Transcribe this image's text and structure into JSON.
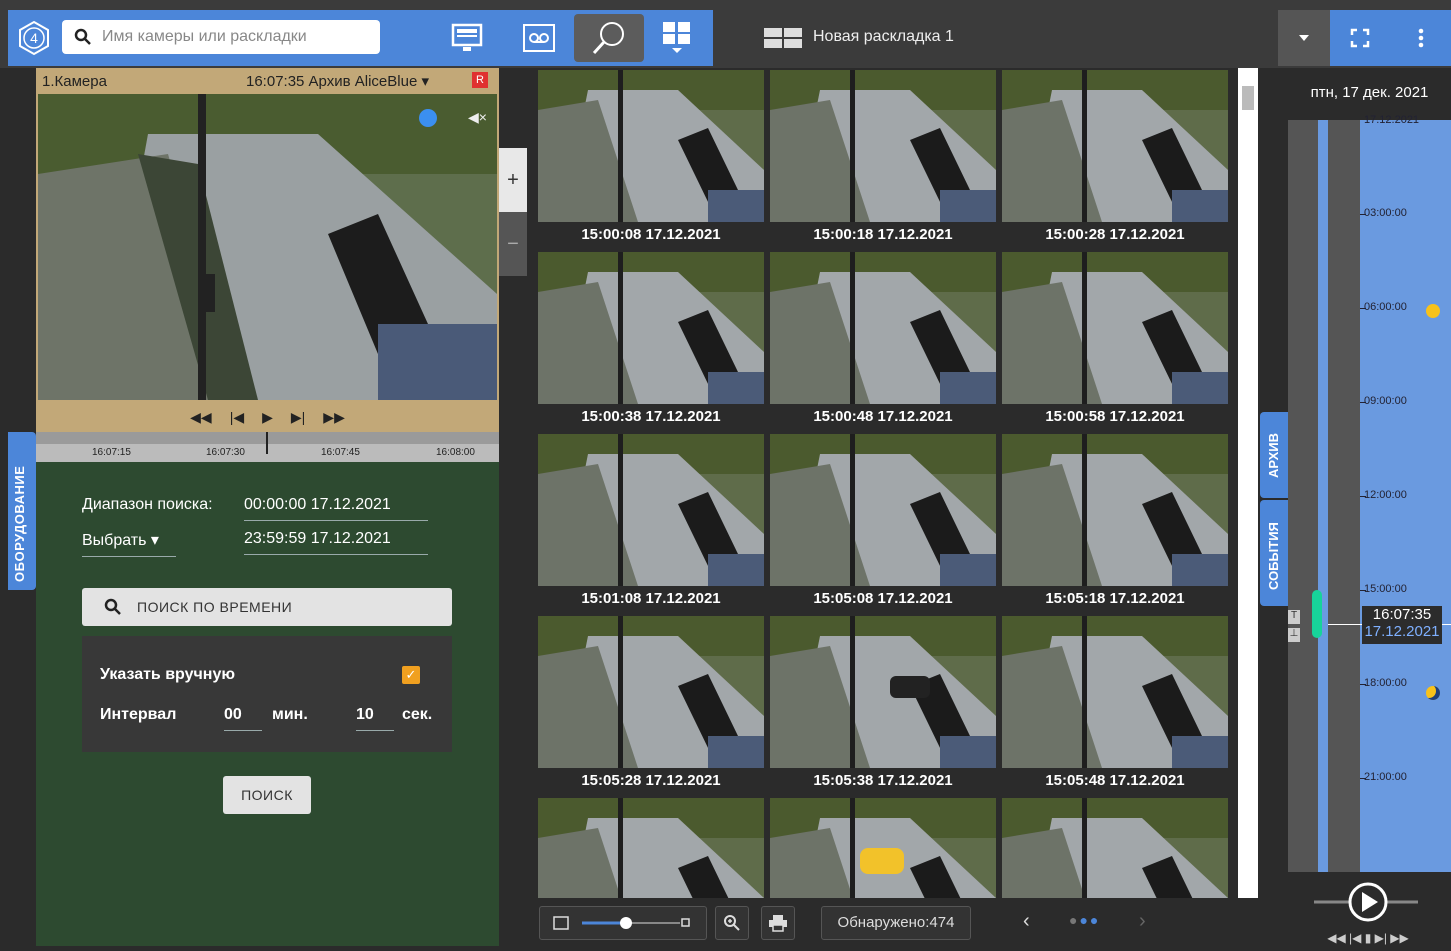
{
  "topbar": {
    "logo_label": "4",
    "search_placeholder": "Имя камеры или раскладки",
    "layout_name": "Новая раскладка 1",
    "buttons": [
      "monitor-icon",
      "archive-icon",
      "search-icon",
      "layouts-icon",
      "fullscreen-icon",
      "more-icon"
    ]
  },
  "equipment_tab": "ОБОРУДОВАНИЕ",
  "camera": {
    "name": "1.Камера",
    "status": "16:07:35 Архив AliceBlue",
    "record_badge": "R",
    "timeline_ticks": [
      "16:07:15",
      "16:07:30",
      "16:07:45",
      "16:08:00"
    ]
  },
  "search_panel": {
    "range_label": "Диапазон поиска:",
    "range_start": "00:00:00 17.12.2021",
    "select_label": "Выбрать",
    "range_end": "23:59:59 17.12.2021",
    "time_search_button": "ПОИСК ПО ВРЕМЕНИ",
    "manual_label": "Указать вручную",
    "manual_checked": true,
    "interval_label": "Интервал",
    "minutes_value": "00",
    "minutes_unit": "мин.",
    "seconds_value": "10",
    "seconds_unit": "сек.",
    "search_button": "ПОИСК"
  },
  "zoom": {
    "plus": "+",
    "minus": "−"
  },
  "thumbnails": [
    {
      "label": "15:00:08 17.12.2021"
    },
    {
      "label": "15:00:18 17.12.2021"
    },
    {
      "label": "15:00:28 17.12.2021"
    },
    {
      "label": "15:00:38 17.12.2021"
    },
    {
      "label": "15:00:48 17.12.2021"
    },
    {
      "label": "15:00:58 17.12.2021"
    },
    {
      "label": "15:01:08 17.12.2021"
    },
    {
      "label": "15:05:08 17.12.2021"
    },
    {
      "label": "15:05:18 17.12.2021"
    },
    {
      "label": "15:05:28 17.12.2021"
    },
    {
      "label": "15:05:38 17.12.2021"
    },
    {
      "label": "15:05:48 17.12.2021"
    },
    {
      "label": ""
    },
    {
      "label": ""
    },
    {
      "label": ""
    }
  ],
  "bottom_bar": {
    "found_text": "Обнаружено:474",
    "prev": "‹",
    "next": "›"
  },
  "side_tabs": {
    "archive": "АРХИВ",
    "events": "СОБЫТИЯ"
  },
  "timeline": {
    "date": "птн, 17 дек. 2021",
    "top_date": "17.12.2021",
    "ticks": [
      "03:00:00",
      "06:00:00",
      "09:00:00",
      "12:00:00",
      "15:00:00",
      "18:00:00",
      "21:00:00"
    ],
    "current_time": "16:07:35",
    "current_date": "17.12.2021"
  }
}
